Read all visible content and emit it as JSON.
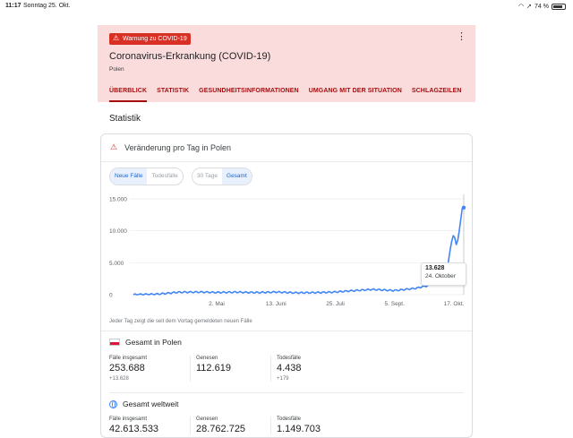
{
  "status_bar": {
    "time": "11:17",
    "date": "Sonntag 25. Okt.",
    "battery": "74 %"
  },
  "header": {
    "warning_badge": "Warnung zu COVID-19",
    "title": "Coronavirus-Erkrankung (COVID-19)",
    "subtitle": "Polen",
    "tabs": [
      {
        "label": "ÜBERBLICK",
        "active": true
      },
      {
        "label": "STATISTIK"
      },
      {
        "label": "GESUNDHEITSINFORMATIONEN"
      },
      {
        "label": "UMGANG MIT DER SITUATION"
      },
      {
        "label": "SCHLAGZEILEN"
      }
    ]
  },
  "section_title": "Statistik",
  "card": {
    "title": "Veränderung pro Tag in Polen",
    "toggle_metric": [
      {
        "label": "Neue Fälle",
        "selected": true
      },
      {
        "label": "Todesfälle",
        "selected": false
      }
    ],
    "toggle_range": [
      {
        "label": "30 Tage",
        "selected": false
      },
      {
        "label": "Gesamt",
        "selected": true
      }
    ],
    "tooltip": {
      "value": "13.628",
      "date": "24. Oktober"
    },
    "note": "Jeder Tag zeigt die seit dem Vortag gemeldeten neuen Fälle",
    "poland": {
      "heading": "Gesamt in Polen",
      "stats": [
        {
          "label": "Fälle insgesamt",
          "value": "253.688",
          "delta": "+13.628"
        },
        {
          "label": "Genesen",
          "value": "112.619",
          "delta": ""
        },
        {
          "label": "Todesfälle",
          "value": "4.438",
          "delta": "+179"
        }
      ]
    },
    "world": {
      "heading": "Gesamt weltweit",
      "stats": [
        {
          "label": "Fälle insgesamt",
          "value": "42.613.533"
        },
        {
          "label": "Genesen",
          "value": "28.762.725"
        },
        {
          "label": "Todesfälle",
          "value": "1.149.703"
        }
      ]
    }
  },
  "colors": {
    "accent_red": "#d93025",
    "tab_red": "#a50e0e",
    "line_blue": "#4285f4",
    "header_bg": "#fbdcdd"
  },
  "chart_data": {
    "type": "line",
    "ylim": [
      0,
      15000
    ],
    "y_ticks": [
      "15.000",
      "10.000",
      "5.000",
      "0"
    ],
    "x_ticks": [
      "2. Mai",
      "13. Juni",
      "25. Juli",
      "5. Sept.",
      "17. Okt."
    ],
    "series": [
      {
        "x": [
          "2020-03-04",
          "2020-03-20",
          "2020-04-05",
          "2020-04-20",
          "2020-05-02",
          "2020-05-15",
          "2020-05-31",
          "2020-06-13",
          "2020-06-27",
          "2020-07-10",
          "2020-07-25",
          "2020-08-08",
          "2020-08-20",
          "2020-09-05",
          "2020-09-20",
          "2020-09-30",
          "2020-10-05",
          "2020-10-09",
          "2020-10-12",
          "2020-10-15",
          "2020-10-17",
          "2020-10-19",
          "2020-10-21",
          "2020-10-23",
          "2020-10-24"
        ],
        "values": [
          0,
          80,
          380,
          420,
          350,
          400,
          330,
          420,
          300,
          320,
          420,
          650,
          820,
          650,
          1000,
          1500,
          2000,
          4300,
          3500,
          8000,
          9600,
          7500,
          10300,
          13600,
          13628
        ]
      }
    ]
  }
}
